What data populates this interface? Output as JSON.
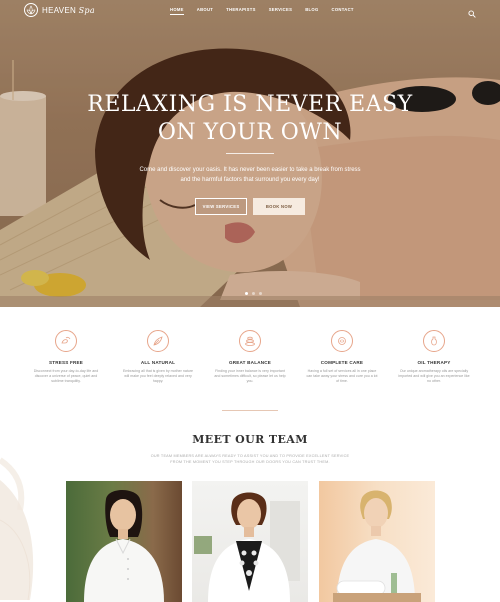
{
  "brand": {
    "name": "HEAVEN",
    "script": "Spa"
  },
  "nav": {
    "items": [
      {
        "label": "HOME",
        "active": true
      },
      {
        "label": "ABOUT",
        "active": false
      },
      {
        "label": "THERAPISTS",
        "active": false
      },
      {
        "label": "SERVICES",
        "active": false
      },
      {
        "label": "BLOG",
        "active": false
      },
      {
        "label": "CONTACT",
        "active": false
      }
    ],
    "search_icon": "search-icon"
  },
  "hero": {
    "title_line1": "RELAXING IS NEVER EASY",
    "title_line2": "ON YOUR OWN",
    "subtitle": "Come and discover your oasis. It has never been easier to take a break from stress and the harmful factors that surround you every day!",
    "btn_services": "VIEW SERVICES",
    "btn_book": "BOOK NOW",
    "slides": 3,
    "active_slide": 1
  },
  "features": [
    {
      "icon": "stress-free-icon",
      "title": "STRESS FREE",
      "text": "Disconnect from your day-to-day life and discover a universe of peace, quiet and sublime tranquility."
    },
    {
      "icon": "all-natural-icon",
      "title": "ALL NATURAL",
      "text": "Embracing all that is given by mother nature will make you feel deeply relaxed and very happy."
    },
    {
      "icon": "great-balance-icon",
      "title": "GREAT BALANCE",
      "text": "Finding your inner balance is very important and sometimes difficult, so please let us help you."
    },
    {
      "icon": "complete-care-icon",
      "title": "COMPLETE CARE",
      "text": "Having a full set of services all in one place can take away your stress and cure you a lot of time."
    },
    {
      "icon": "oil-therapy-icon",
      "title": "OIL THERAPY",
      "text": "Our unique aromatherapy oils are specially imported and will give you an experience like no other."
    }
  ],
  "team": {
    "title": "MEET OUR TEAM",
    "subtitle_line1": "OUR TEAM MEMBERS ARE ALWAYS READY TO ASSIST YOU AND TO PROVIDE EXCELLENT SERVICE",
    "subtitle_line2": "FROM THE MOMENT YOU STEP THROUGH OUR DOORS YOU CAN TRUST THEM."
  },
  "colors": {
    "accent": "#e7a58a",
    "button_light": "#f6ebe0",
    "button_text": "#7a5a3e"
  }
}
